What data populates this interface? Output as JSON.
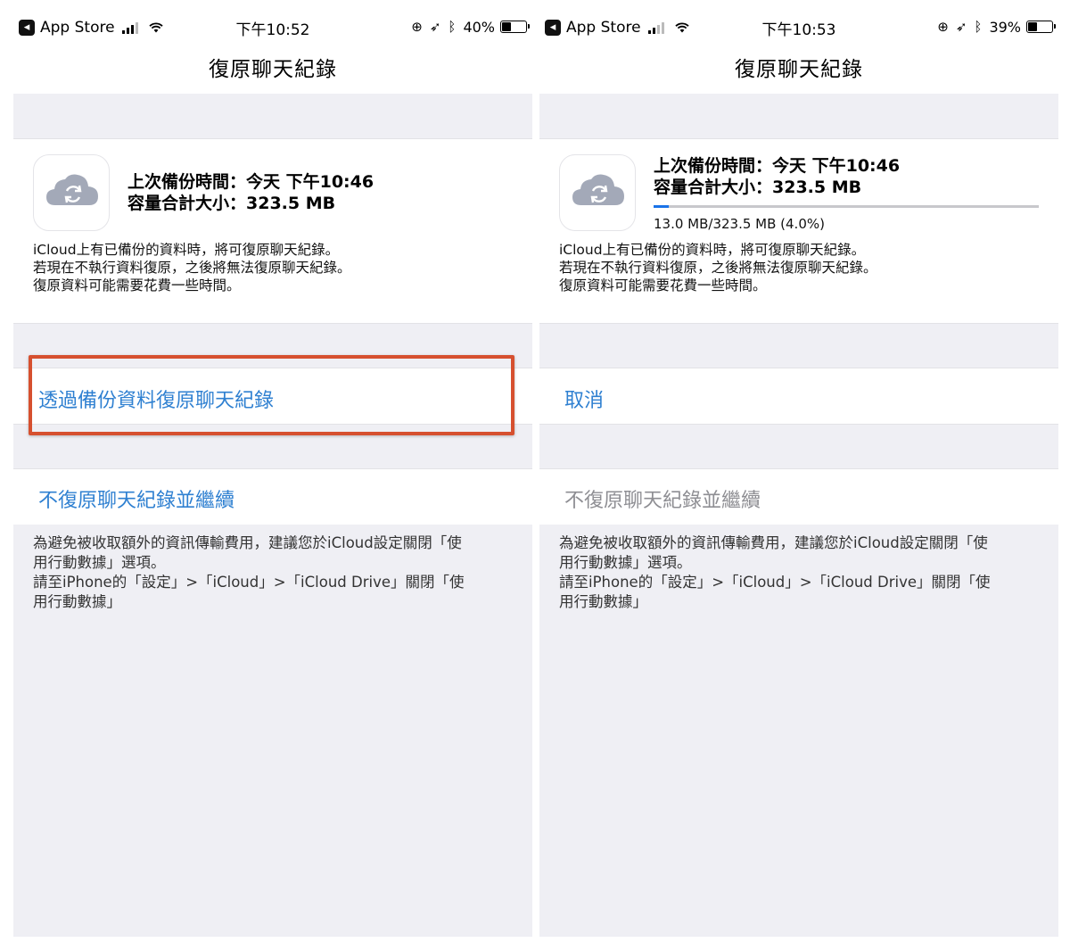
{
  "left": {
    "status": {
      "app": "App Store",
      "time": "下午10:52",
      "battery": "40%",
      "battery_level": 0.4
    },
    "nav_title": "復原聊天紀錄",
    "backup": {
      "last_time": "上次備份時間：今天 下午10:46",
      "total_size": "容量合計大小：323.5 MB"
    },
    "description": [
      "iCloud上有已備份的資料時，將可復原聊天紀錄。",
      "若現在不執行資料復原，之後將無法復原聊天紀錄。",
      "復原資料可能需要花費一些時間。"
    ],
    "primary_action": "透過備份資料復原聊天紀錄",
    "secondary_action": "不復原聊天紀錄並繼續",
    "footer": [
      "為避免被收取額外的資訊傳輸費用，建議您於iCloud設定關閉「使",
      "用行動數據」選項。",
      "請至iPhone的「設定」>「iCloud」>「iCloud Drive」關閉「使",
      "用行動數據」"
    ]
  },
  "right": {
    "status": {
      "app": "App Store",
      "time": "下午10:53",
      "battery": "39%",
      "battery_level": 0.39
    },
    "nav_title": "復原聊天紀錄",
    "backup": {
      "last_time": "上次備份時間：今天 下午10:46",
      "total_size": "容量合計大小：323.5 MB",
      "progress_label": "13.0 MB/323.5 MB (4.0%)",
      "progress": 0.04
    },
    "description": [
      "iCloud上有已備份的資料時，將可復原聊天紀錄。",
      "若現在不執行資料復原，之後將無法復原聊天紀錄。",
      "復原資料可能需要花費一些時間。"
    ],
    "primary_action": "取消",
    "secondary_action": "不復原聊天紀錄並繼續",
    "footer": [
      "為避免被收取額外的資訊傳輸費用，建議您於iCloud設定關閉「使",
      "用行動數據」選項。",
      "請至iPhone的「設定」>「iCloud」>「iCloud Drive」關閉「使",
      "用行動數據」"
    ]
  },
  "colors": {
    "link_blue": "#2f80d1",
    "disabled_gray": "#8e8e93",
    "group_background": "#efeff4",
    "highlight_red": "#d6502f",
    "progress_blue": "#1a73e8"
  },
  "icons": {
    "back": "back-to-app-icon",
    "cloud": "icloud-sync-icon",
    "wifi": "wifi-icon",
    "location": "location-arrow-icon",
    "bluetooth": "bluetooth-icon",
    "rotation_lock": "rotation-lock-icon",
    "battery": "battery-icon"
  }
}
